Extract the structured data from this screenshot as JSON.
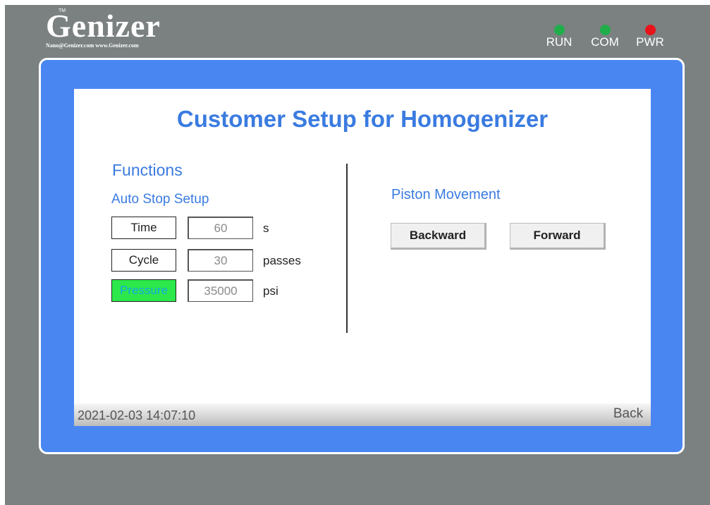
{
  "brand": {
    "name": "Genizer",
    "tm": "TM",
    "subtitle": "Nano@Genizer.com  www.Genizer.com"
  },
  "indicators": [
    {
      "label": "RUN",
      "color": "#1fae4a"
    },
    {
      "label": "COM",
      "color": "#1fae4a"
    },
    {
      "label": "PWR",
      "color": "#e8131b"
    }
  ],
  "screen": {
    "title": "Customer Setup for Homogenizer",
    "functions_heading": "Functions",
    "auto_stop_heading": "Auto Stop Setup",
    "auto_stop": [
      {
        "label": "Time",
        "value": "60",
        "unit": "s",
        "active": false
      },
      {
        "label": "Cycle",
        "value": "30",
        "unit": "passes",
        "active": false
      },
      {
        "label": "Pressure",
        "value": "35000",
        "unit": "psi",
        "active": true
      }
    ],
    "piston_heading": "Piston Movement",
    "backward_label": "Backward",
    "forward_label": "Forward"
  },
  "status": {
    "datetime": "2021-02-03 14:07:10",
    "back_label": "Back"
  },
  "colors": {
    "frame_blue": "#4a86f2",
    "heading_blue": "#3a7be0",
    "active_green": "#2ce84a",
    "bezel_gray": "#7b8181"
  }
}
